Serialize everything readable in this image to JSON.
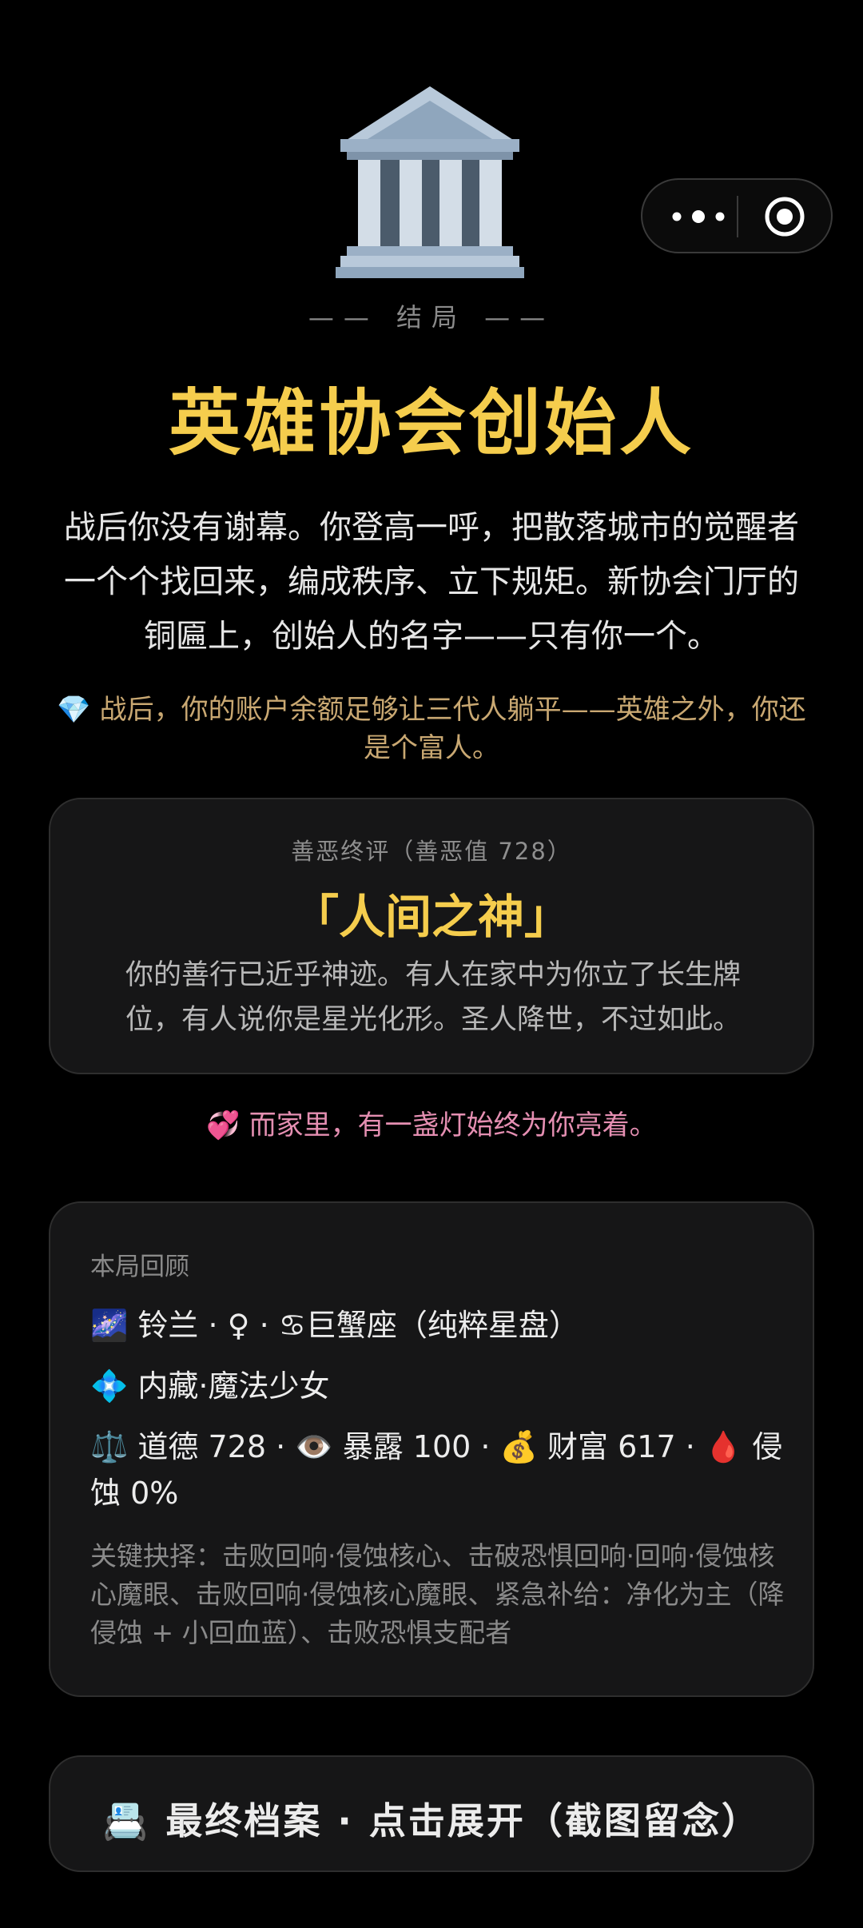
{
  "ending": {
    "icon": "classical-building-icon",
    "label": "—— 结局 ——",
    "title": "英雄协会创始人",
    "story": "战后你没有谢幕。你登高一呼，把散落城市的觉醒者一个个找回来，编成秩序、立下规矩。新协会门厅的铜匾上，创始人的名字——只有你一个。",
    "wealth_icon": "💎",
    "wealth_text": "战后，你的账户余额足够让三代人躺平——英雄之外，你还是个富人。"
  },
  "verdict": {
    "title": "善恶终评（善恶值 728）",
    "name": "「人间之神」",
    "desc": "你的善行已近乎神迹。有人在家中为你立了长生牌位，有人说你是星光化形。圣人降世，不过如此。"
  },
  "family": {
    "icon": "💞",
    "text": "而家里，有一盏灯始终为你亮着。"
  },
  "review": {
    "heading": "本局回顾",
    "identity_icon": "🌌",
    "identity": "铃兰 · ♀ · ",
    "zodiac_icon": "♋",
    "zodiac": "巨蟹座（纯粹星盘）",
    "class_icon": "💠",
    "class": "内藏·魔法少女",
    "stats": [
      {
        "icon": "⚖️",
        "label": "道德 728"
      },
      {
        "icon": "👁️",
        "label": "暴露 100"
      },
      {
        "icon": "💰",
        "label": "财富 617"
      },
      {
        "icon": "🩸",
        "label": "侵蚀 0%"
      }
    ],
    "key_choices": "关键抉择：击败回响·侵蚀核心、击破恐惧回响·回响·侵蚀核心魔眼、击败回响·侵蚀核心魔眼、紧急补给：净化为主（降侵蚀 + 小回血蓝）、击败恐惧支配者"
  },
  "archive": {
    "icon": "📇",
    "label": "最终档案 · 点击展开（截图留念）"
  },
  "capsule": {
    "more_icon": "more-dots-icon",
    "close_icon": "target-close-icon"
  }
}
